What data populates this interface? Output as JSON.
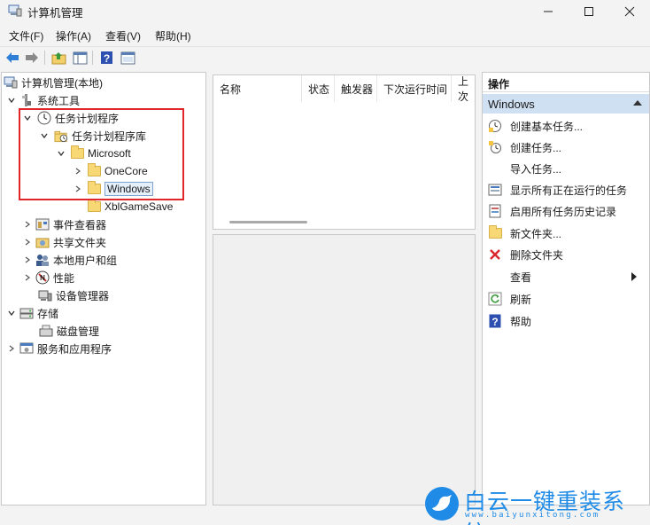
{
  "window": {
    "title": "计算机管理",
    "icon": "computer-management-icon"
  },
  "menu": [
    "文件(F)",
    "操作(A)",
    "查看(V)",
    "帮助(H)"
  ],
  "toolbar": [
    "back-arrow-icon",
    "forward-arrow-icon",
    "up-folder-icon",
    "show-hide-tree-icon",
    "help-icon",
    "properties-icon"
  ],
  "tree": {
    "root": "计算机管理(本地)",
    "system_tools": "系统工具",
    "task_scheduler": "任务计划程序",
    "task_scheduler_library": "任务计划程序库",
    "microsoft": "Microsoft",
    "onecore": "OneCore",
    "windows": "Windows",
    "xblgamesave": "XblGameSave",
    "event_viewer": "事件查看器",
    "shared_folders": "共享文件夹",
    "local_users_groups": "本地用户和组",
    "performance": "性能",
    "device_manager": "设备管理器",
    "storage": "存储",
    "disk_management": "磁盘管理",
    "services_apps": "服务和应用程序"
  },
  "list": {
    "columns": [
      "名称",
      "状态",
      "触发器",
      "下次运行时间",
      "上次"
    ]
  },
  "actions": {
    "header": "操作",
    "section": "Windows",
    "items": [
      {
        "label": "创建基本任务...",
        "icon": "create-basic-task-icon"
      },
      {
        "label": "创建任务...",
        "icon": "create-task-icon"
      },
      {
        "label": "导入任务...",
        "icon": ""
      },
      {
        "label": "显示所有正在运行的任务",
        "icon": "running-tasks-icon"
      },
      {
        "label": "启用所有任务历史记录",
        "icon": "task-history-icon"
      },
      {
        "label": "新文件夹...",
        "icon": "new-folder-icon"
      },
      {
        "label": "删除文件夹",
        "icon": "delete-icon"
      },
      {
        "label": "查看",
        "icon": ""
      },
      {
        "label": "刷新",
        "icon": "refresh-icon"
      },
      {
        "label": "帮助",
        "icon": "help-icon"
      }
    ]
  },
  "watermark": {
    "title": "白云一键重装系统",
    "url": "www.baiyunxitong.com"
  },
  "colors": {
    "highlight_box": "#e0262b",
    "action_section_bg": "#cfe0f2",
    "watermark_blue": "#1f8be6"
  }
}
